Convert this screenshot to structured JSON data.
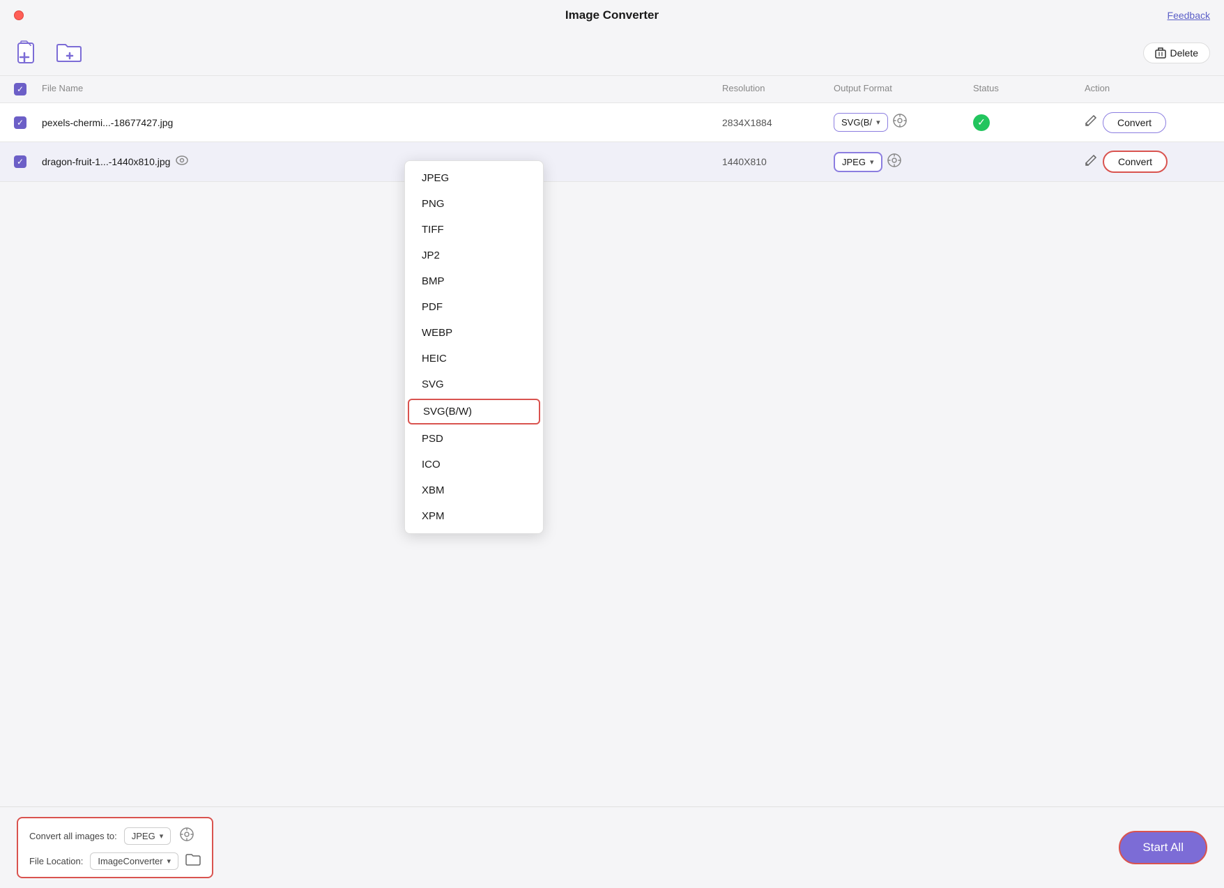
{
  "app": {
    "title": "Image Converter",
    "feedback_label": "Feedback",
    "traffic_light_color": "#ff5f57"
  },
  "toolbar": {
    "add_file_label": "Add File",
    "add_folder_label": "Add Folder",
    "delete_label": "Delete"
  },
  "table": {
    "headers": [
      "",
      "File Name",
      "Resolution",
      "Output Format",
      "Status",
      "Action"
    ],
    "rows": [
      {
        "checked": true,
        "file_name": "pexels-chermi...-18677427.jpg",
        "resolution": "2834X1884",
        "format": "SVG(B/",
        "status": "success",
        "convert_label": "Convert"
      },
      {
        "checked": true,
        "file_name": "dragon-fruit-1...-1440x810.jpg",
        "resolution": "1440X810",
        "format": "JPEG",
        "status": "",
        "convert_label": "Convert"
      }
    ]
  },
  "dropdown": {
    "items": [
      "JPEG",
      "PNG",
      "TIFF",
      "JP2",
      "BMP",
      "PDF",
      "WEBP",
      "HEIC",
      "SVG",
      "SVG(B/W)",
      "PSD",
      "ICO",
      "XBM",
      "XPM"
    ],
    "selected": "SVG(B/W)"
  },
  "bottom_bar": {
    "convert_all_label": "Convert all images to:",
    "format_value": "JPEG",
    "file_location_label": "File Location:",
    "location_value": "ImageConverter",
    "start_all_label": "Start  All"
  }
}
